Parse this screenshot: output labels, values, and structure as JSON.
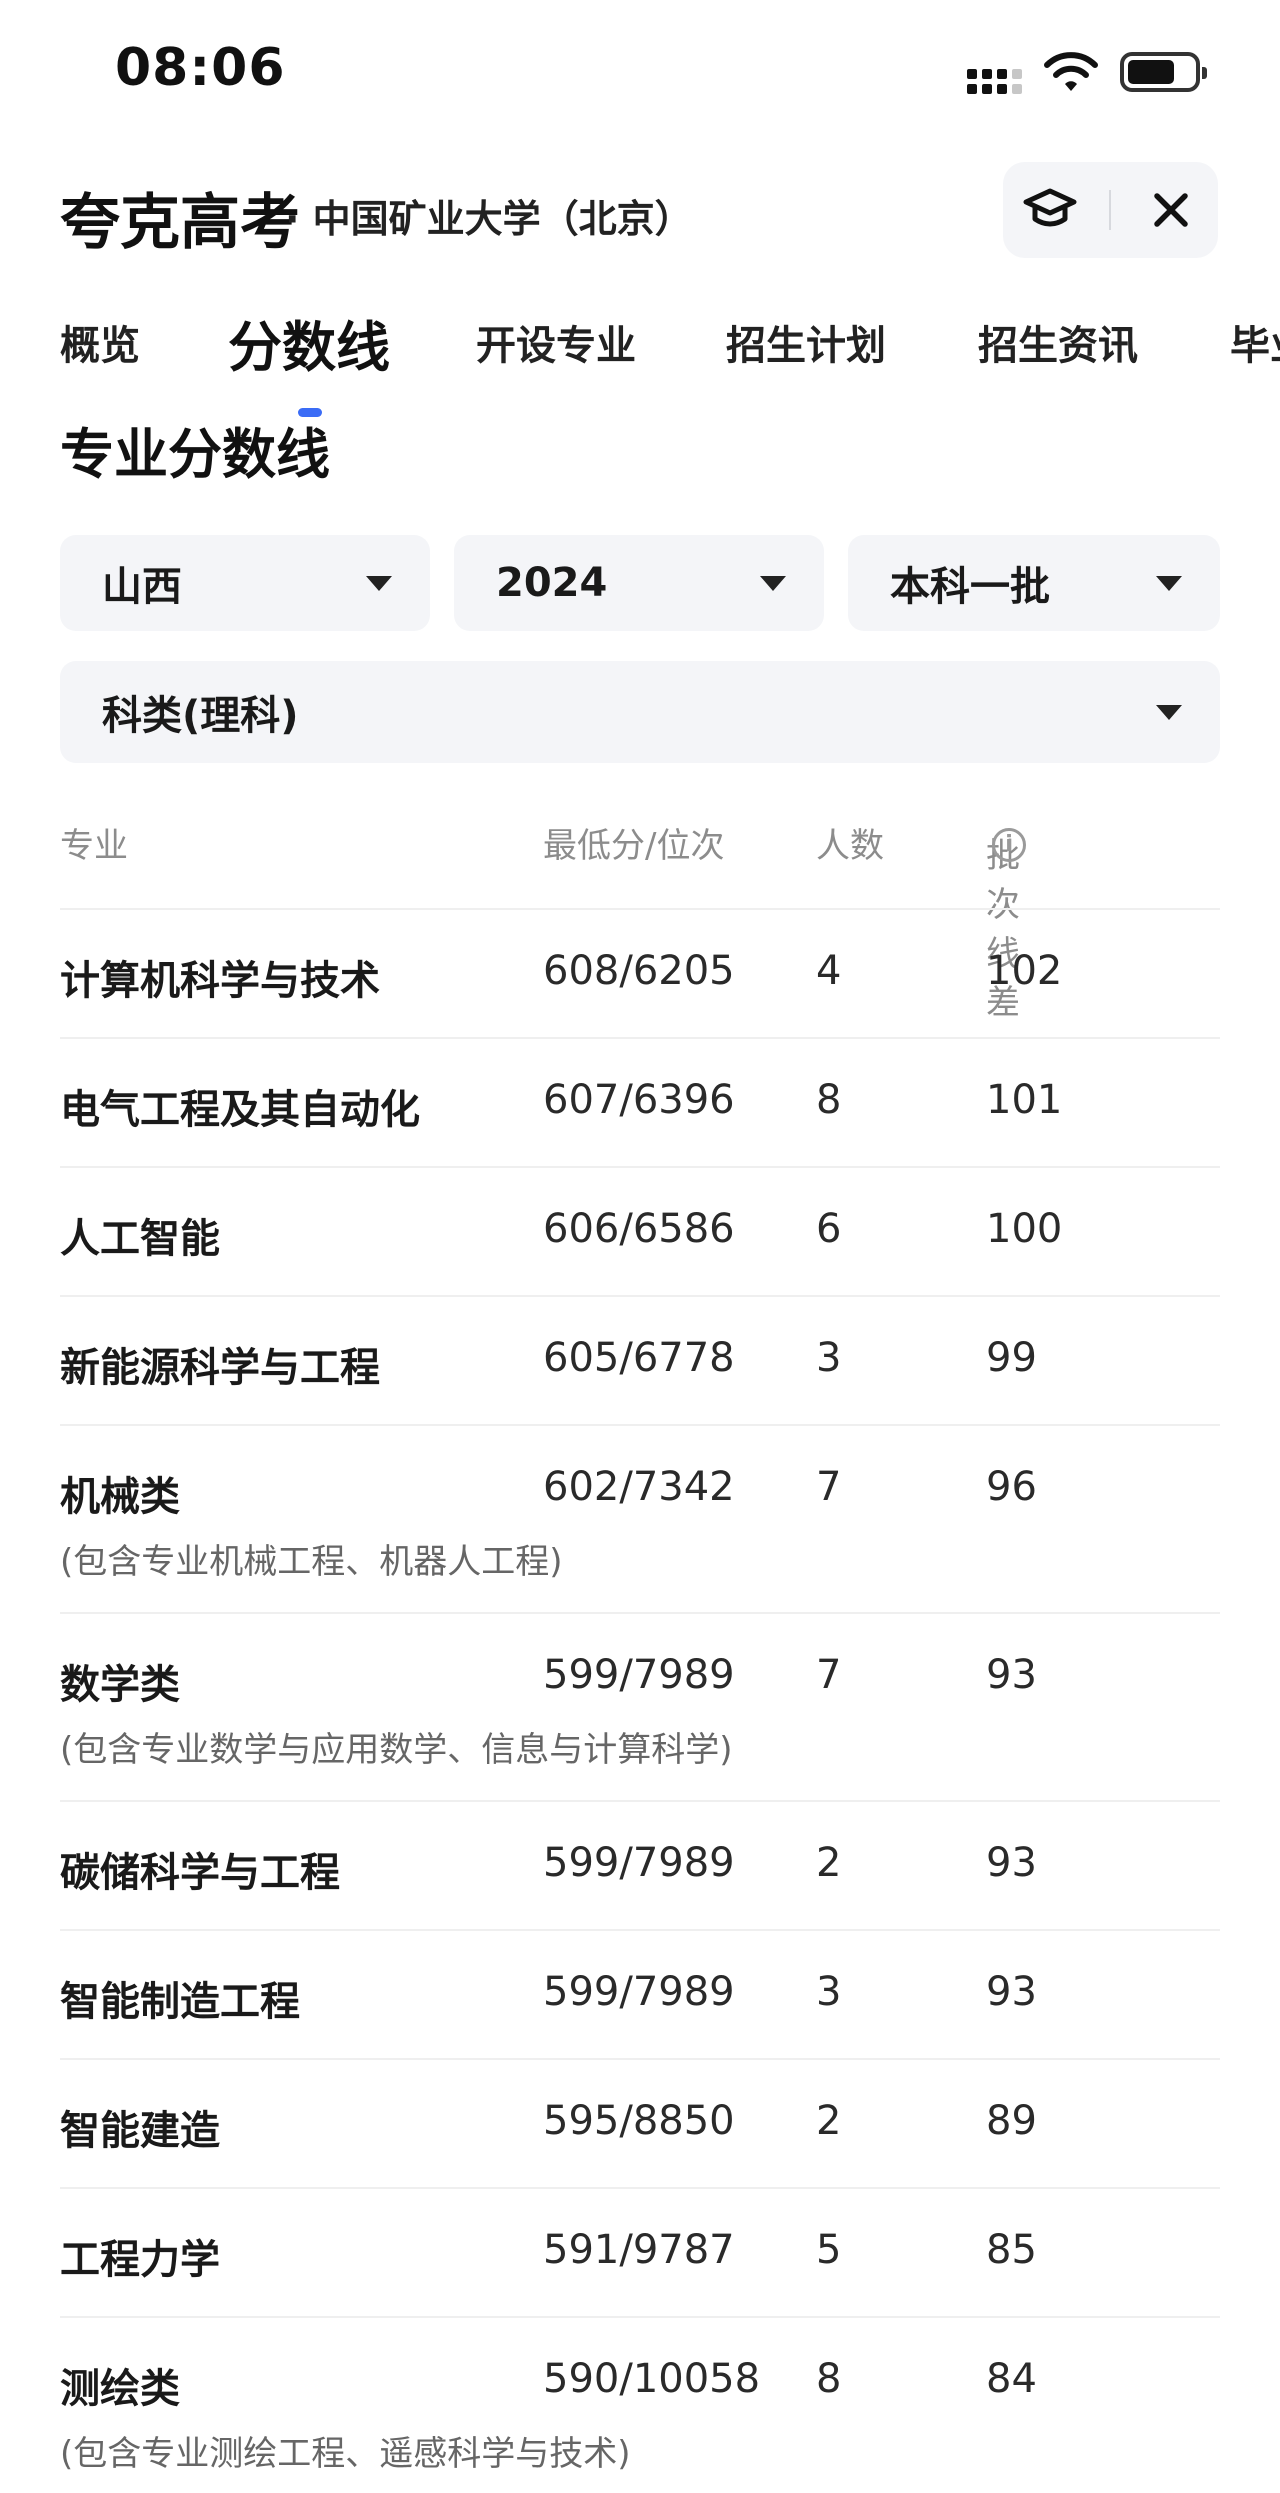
{
  "status": {
    "time": "08:06"
  },
  "header": {
    "brand": "夸克高考",
    "school": "· 中国矿业大学（北京）"
  },
  "tabs": [
    "概览",
    "分数线",
    "开设专业",
    "招生计划",
    "招生资讯",
    "毕业"
  ],
  "active_tab": 1,
  "section_title": "专业分数线",
  "filters": {
    "province": "山西",
    "year": "2024",
    "batch": "本科一批",
    "subject": "科类(理科)"
  },
  "table": {
    "headers": {
      "major": "专业",
      "score_rank": "最低分/位次",
      "count": "人数",
      "diff": "批次线差",
      "info_glyph": "i"
    },
    "rows": [
      {
        "major": "计算机科学与技术",
        "score": "608/6205",
        "count": "4",
        "diff": "102",
        "note": ""
      },
      {
        "major": "电气工程及其自动化",
        "score": "607/6396",
        "count": "8",
        "diff": "101",
        "note": ""
      },
      {
        "major": "人工智能",
        "score": "606/6586",
        "count": "6",
        "diff": "100",
        "note": ""
      },
      {
        "major": "新能源科学与工程",
        "score": "605/6778",
        "count": "3",
        "diff": "99",
        "note": ""
      },
      {
        "major": "机械类",
        "score": "602/7342",
        "count": "7",
        "diff": "96",
        "note": "(包含专业机械工程、机器人工程)"
      },
      {
        "major": "数学类",
        "score": "599/7989",
        "count": "7",
        "diff": "93",
        "note": "(包含专业数学与应用数学、信息与计算科学)"
      },
      {
        "major": "碳储科学与工程",
        "score": "599/7989",
        "count": "2",
        "diff": "93",
        "note": ""
      },
      {
        "major": "智能制造工程",
        "score": "599/7989",
        "count": "3",
        "diff": "93",
        "note": ""
      },
      {
        "major": "智能建造",
        "score": "595/8850",
        "count": "2",
        "diff": "89",
        "note": ""
      },
      {
        "major": "工程力学",
        "score": "591/9787",
        "count": "5",
        "diff": "85",
        "note": ""
      },
      {
        "major": "测绘类",
        "score": "590/10058",
        "count": "8",
        "diff": "84",
        "note": "(包含专业测绘工程、遥感科学与技术)"
      }
    ]
  },
  "icons": {
    "signal": "cellular-signal-icon",
    "wifi": "wifi-icon",
    "battery": "battery-icon",
    "cap": "graduation-cap-icon",
    "close": "close-icon",
    "caret": "caret-down-icon",
    "info": "info-icon"
  }
}
